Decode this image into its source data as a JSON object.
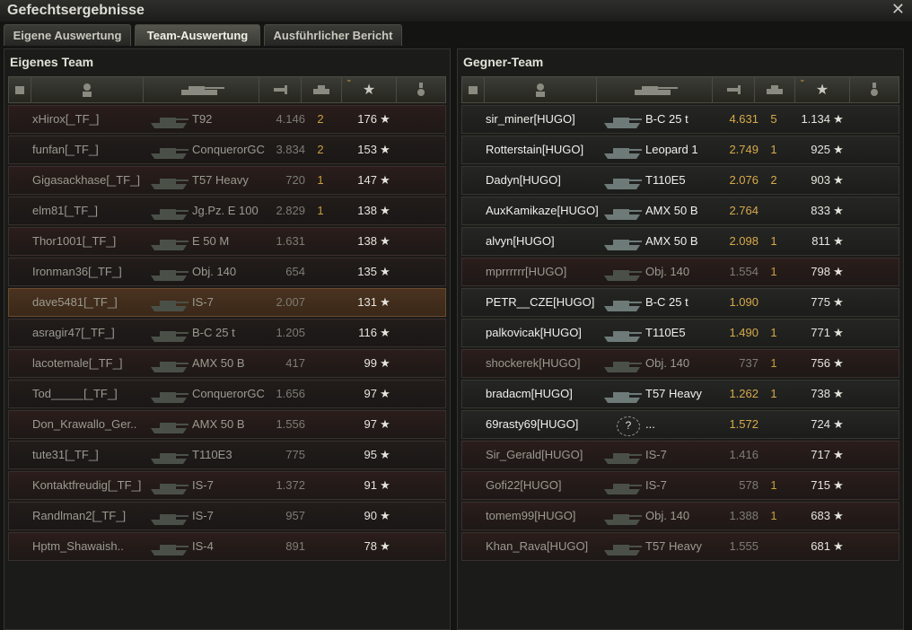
{
  "window": {
    "title": "Gefechtsergebnisse",
    "close_icon": "close-icon"
  },
  "tabs": [
    {
      "label": "Eigene Auswertung",
      "active": false
    },
    {
      "label": "Team-Auswertung",
      "active": true
    },
    {
      "label": "Ausführlicher Bericht",
      "active": false
    }
  ],
  "header_icons": {
    "squad": "squad-icon",
    "player": "player-icon",
    "vehicle": "tank-icon",
    "damage": "damage-icon",
    "kills": "kills-icon",
    "score": "star-icon",
    "medal": "medal-icon"
  },
  "own_team": {
    "title": "Eigenes Team",
    "rows": [
      {
        "name": "xHirox[_TF_]",
        "vehicle": "T92",
        "xp": "4.146",
        "kills": "2",
        "score": "176",
        "state": "dead"
      },
      {
        "name": "funfan[_TF_]",
        "vehicle": "ConquerorGC",
        "xp": "3.834",
        "kills": "2",
        "score": "153",
        "state": "dead"
      },
      {
        "name": "Gigasackhase[_TF_]",
        "vehicle": "T57 Heavy",
        "xp": "720",
        "kills": "1",
        "score": "147",
        "state": "dead"
      },
      {
        "name": "elm81[_TF_]",
        "vehicle": "Jg.Pz. E 100",
        "xp": "2.829",
        "kills": "1",
        "score": "138",
        "state": "dead"
      },
      {
        "name": "Thor1001[_TF_]",
        "vehicle": "E 50 M",
        "xp": "1.631",
        "kills": "",
        "score": "138",
        "state": "dead"
      },
      {
        "name": "Ironman36[_TF_]",
        "vehicle": "Obj. 140",
        "xp": "654",
        "kills": "",
        "score": "135",
        "state": "dead"
      },
      {
        "name": "dave5481[_TF_]",
        "vehicle": "IS-7",
        "xp": "2.007",
        "kills": "",
        "score": "131",
        "state": "self"
      },
      {
        "name": "asragir47[_TF_]",
        "vehicle": "B-C 25 t",
        "xp": "1.205",
        "kills": "",
        "score": "116",
        "state": "dead"
      },
      {
        "name": "lacotemale[_TF_]",
        "vehicle": "AMX 50 B",
        "xp": "417",
        "kills": "",
        "score": "99",
        "state": "dead"
      },
      {
        "name": "Tod_____[_TF_]",
        "vehicle": "ConquerorGC",
        "xp": "1.656",
        "kills": "",
        "score": "97",
        "state": "dead"
      },
      {
        "name": "Don_Krawallo_Ger..",
        "vehicle": "AMX 50 B",
        "xp": "1.556",
        "kills": "",
        "score": "97",
        "state": "dead"
      },
      {
        "name": "tute31[_TF_]",
        "vehicle": "T110E3",
        "xp": "775",
        "kills": "",
        "score": "95",
        "state": "dead"
      },
      {
        "name": "Kontaktfreudig[_TF_]",
        "vehicle": "IS-7",
        "xp": "1.372",
        "kills": "",
        "score": "91",
        "state": "dead"
      },
      {
        "name": "Randlman2[_TF_]",
        "vehicle": "IS-7",
        "xp": "957",
        "kills": "",
        "score": "90",
        "state": "dead"
      },
      {
        "name": "Hptm_Shawaish..",
        "vehicle": "IS-4",
        "xp": "891",
        "kills": "",
        "score": "78",
        "state": "dead"
      }
    ]
  },
  "enemy_team": {
    "title": "Gegner-Team",
    "rows": [
      {
        "name": "sir_miner[HUGO]",
        "vehicle": "B-C 25 t",
        "xp": "4.631",
        "kills": "5",
        "score": "1.134",
        "state": "alive"
      },
      {
        "name": "Rotterstain[HUGO]",
        "vehicle": "Leopard 1",
        "xp": "2.749",
        "kills": "1",
        "score": "925",
        "state": "alive"
      },
      {
        "name": "Dadyn[HUGO]",
        "vehicle": "T110E5",
        "xp": "2.076",
        "kills": "2",
        "score": "903",
        "state": "alive"
      },
      {
        "name": "AuxKamikaze[HUGO]",
        "vehicle": "AMX 50 B",
        "xp": "2.764",
        "kills": "",
        "score": "833",
        "state": "alive"
      },
      {
        "name": "alvyn[HUGO]",
        "vehicle": "AMX 50 B",
        "xp": "2.098",
        "kills": "1",
        "score": "811",
        "state": "alive"
      },
      {
        "name": "mprrrrrr[HUGO]",
        "vehicle": "Obj. 140",
        "xp": "1.554",
        "kills": "1",
        "score": "798",
        "state": "dead"
      },
      {
        "name": "PETR__CZE[HUGO]",
        "vehicle": "B-C 25 t",
        "xp": "1.090",
        "kills": "",
        "score": "775",
        "state": "alive"
      },
      {
        "name": "palkovicak[HUGO]",
        "vehicle": "T110E5",
        "xp": "1.490",
        "kills": "1",
        "score": "771",
        "state": "alive"
      },
      {
        "name": "shockerek[HUGO]",
        "vehicle": "Obj. 140",
        "xp": "737",
        "kills": "1",
        "score": "756",
        "state": "dead"
      },
      {
        "name": "bradacm[HUGO]",
        "vehicle": "T57 Heavy",
        "xp": "1.262",
        "kills": "1",
        "score": "738",
        "state": "alive"
      },
      {
        "name": "69rasty69[HUGO]",
        "vehicle": "...",
        "xp": "1.572",
        "kills": "",
        "score": "724",
        "state": "alive",
        "unknown": true
      },
      {
        "name": "Sir_Gerald[HUGO]",
        "vehicle": "IS-7",
        "xp": "1.416",
        "kills": "",
        "score": "717",
        "state": "dead"
      },
      {
        "name": "Gofi22[HUGO]",
        "vehicle": "IS-7",
        "xp": "578",
        "kills": "1",
        "score": "715",
        "state": "dead"
      },
      {
        "name": "tomem99[HUGO]",
        "vehicle": "Obj. 140",
        "xp": "1.388",
        "kills": "1",
        "score": "683",
        "state": "dead"
      },
      {
        "name": "Khan_Rava[HUGO]",
        "vehicle": "T57 Heavy",
        "xp": "1.555",
        "kills": "",
        "score": "681",
        "state": "dead"
      }
    ]
  },
  "colors": {
    "accent_gold": "#d8a94a",
    "alive_text": "#f0f0ea",
    "dead_text": "#9a9a90"
  }
}
